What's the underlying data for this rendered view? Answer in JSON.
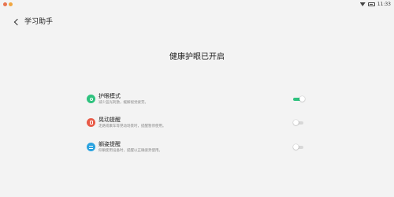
{
  "status_bar": {
    "time": "11:33",
    "dot_colors": [
      "#e8744f",
      "#f0a640"
    ],
    "icons": [
      "wifi-icon",
      "battery-icon"
    ]
  },
  "header": {
    "back_icon": "chevron-left-icon",
    "title": "学习助手"
  },
  "main": {
    "heading": "健康护眼已开启",
    "settings": [
      {
        "label": "护眼模式",
        "description": "减少蓝光刺激，缓解视觉疲劳。",
        "icon": "eye-icon",
        "icon_color": "#2ec27e",
        "enabled": true
      },
      {
        "label": "晃动提醒",
        "description": "走路或乘车等晃动场景时，提醒暂停使用。",
        "icon": "shake-phone-icon",
        "icon_color": "#e85a47",
        "enabled": false
      },
      {
        "label": "躺姿提醒",
        "description": "仰躺使用设备时，提醒以正确姿势使用。",
        "icon": "lying-posture-icon",
        "icon_color": "#2ba3e0",
        "enabled": false
      }
    ]
  }
}
